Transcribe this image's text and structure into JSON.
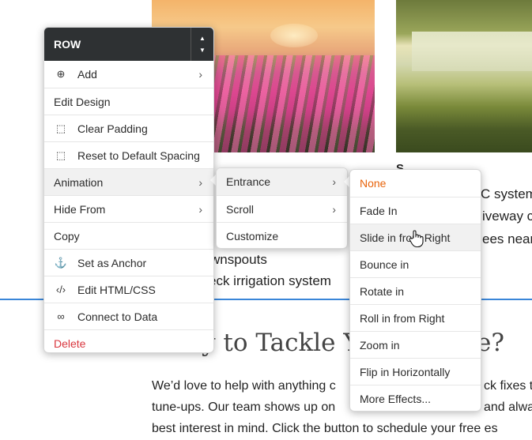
{
  "row_menu": {
    "title": "ROW",
    "arrow_up": "▲",
    "arrow_down": "▼",
    "items": [
      {
        "label": "Add",
        "icon": "plus-circle-icon",
        "glyph": "⊕",
        "submenu": true
      },
      {
        "label": "Edit Design",
        "icon": "",
        "glyph": "",
        "submenu": false
      },
      {
        "label": "Clear Padding",
        "icon": "padding-icon",
        "glyph": "⬚",
        "submenu": false
      },
      {
        "label": "Reset to Default Spacing",
        "icon": "spacing-icon",
        "glyph": "⬚",
        "submenu": false
      },
      {
        "label": "Animation",
        "icon": "",
        "glyph": "",
        "submenu": true,
        "active": true
      },
      {
        "label": "Hide From",
        "icon": "",
        "glyph": "",
        "submenu": true
      },
      {
        "label": "Copy",
        "icon": "",
        "glyph": "",
        "submenu": false
      },
      {
        "label": "Set as Anchor",
        "icon": "anchor-icon",
        "glyph": "⚓",
        "submenu": false
      },
      {
        "label": "Edit HTML/CSS",
        "icon": "code-icon",
        "glyph": "‹/›",
        "submenu": false
      },
      {
        "label": "Connect to Data",
        "icon": "link-icon",
        "glyph": "∞",
        "submenu": false
      },
      {
        "label": "Delete",
        "icon": "",
        "glyph": "",
        "submenu": false,
        "danger": true
      }
    ]
  },
  "animation_menu": {
    "items": [
      {
        "label": "Entrance",
        "submenu": true,
        "active": true
      },
      {
        "label": "Scroll",
        "submenu": true
      },
      {
        "label": "Customize",
        "submenu": false
      }
    ]
  },
  "entrance_menu": {
    "items": [
      {
        "label": "None",
        "selected": true
      },
      {
        "label": "Fade In"
      },
      {
        "label": "Slide in from Right",
        "hovered": true
      },
      {
        "label": "Bounce in"
      },
      {
        "label": "Rotate in"
      },
      {
        "label": "Roll in from Right"
      },
      {
        "label": "Zoom in"
      },
      {
        "label": "Flip in Horizontally"
      },
      {
        "label": "More Effects..."
      }
    ]
  },
  "chevron": "›",
  "background": {
    "right_col_title": "S",
    "right_col_lines": [
      "C system",
      "iveway c",
      "ees near"
    ],
    "list_line_1": "wnspouts",
    "list_line_2": "eck irrigation system",
    "heading_left": "y to Tackle Yo",
    "heading_right": "e?",
    "body_line_1a": "We’d love to help with anything c",
    "body_line_1b": "ck fixes t",
    "body_line_2a": "tune-ups. Our team shows up on",
    "body_line_2b": "and alwa",
    "body_line_3": "best interest in mind. Click the button to schedule your free es"
  },
  "colors": {
    "header_bg": "#2e3133",
    "accent_line": "#3a86d8",
    "selected_orange": "#e8630a",
    "delete_red": "#d9363e"
  }
}
